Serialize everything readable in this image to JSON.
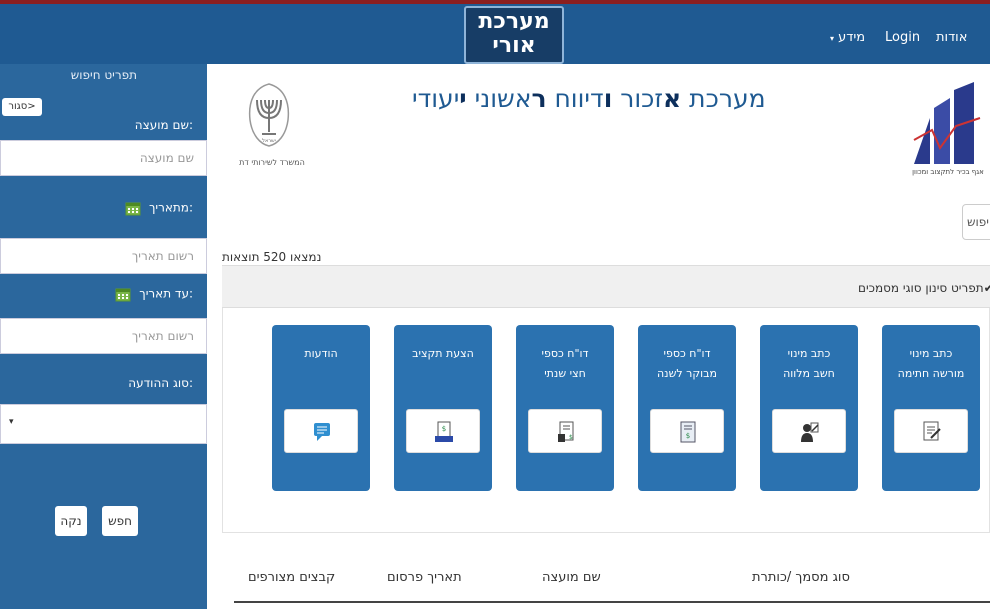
{
  "nav": {
    "brand_line1": "מערכת",
    "brand_line2": "אורי",
    "about": "אודות",
    "login": "Login",
    "info": "מידע",
    "info_caret": "▾"
  },
  "header": {
    "title_prefix": "מערכת ",
    "title_b1": "א",
    "title_p1": "זכור ",
    "title_b2": "ו",
    "title_p2": "דיווח ",
    "title_b3": "ר",
    "title_p3": "אשוני ",
    "title_b4": "י",
    "title_p4": "יעודי",
    "emblem_caption": "המשרד לשירותי דת",
    "emblem_text": "ישראל",
    "logo_caption": "אגף בכיר לתקצוב ומכוון"
  },
  "sidebar": {
    "title": "תפריט חיפוש",
    "collapse": "סגור>",
    "council_label": "שם מועצה:",
    "council_placeholder": "שם מועצה",
    "from_label": "מתאריך:",
    "from_placeholder": "רשום תאריך",
    "to_label": "עד תאריך:",
    "to_placeholder": "רשום תאריך",
    "type_label": "סוג ההודעה:",
    "type_arrow": "▾",
    "search_btn": "חפש",
    "clear_btn": "נקה"
  },
  "search": {
    "label": "חיפוש"
  },
  "results": {
    "count_text": "נמצאו 520 תוצאות"
  },
  "filter": {
    "label": "תפריט סינון סוגי מסמכים",
    "chevron": "✔"
  },
  "cards": [
    {
      "line1": "כתב מינוי",
      "line2": "מורשה חתימה",
      "icon": "signature-doc-icon"
    },
    {
      "line1": "כתב מינוי",
      "line2": "חשב מלווה",
      "icon": "accountant-icon"
    },
    {
      "line1": "דו\"ח כספי",
      "line2": "מבוקר לשנה",
      "icon": "annual-report-icon"
    },
    {
      "line1": "דו\"ח כספי",
      "line2": "חצי שנתי",
      "icon": "semiannual-report-icon"
    },
    {
      "line1": "הצעת תקציב",
      "line2": "",
      "icon": "budget-proposal-icon"
    },
    {
      "line1": "הודעות",
      "line2": "",
      "icon": "messages-icon"
    }
  ],
  "table": {
    "col_doc": "סוג מסמך /כותרת",
    "col_council": "שם מועצה",
    "col_date": "תאריך פרסום",
    "col_files": "קבצים מצורפים"
  },
  "colors": {
    "primary": "#1f5a92",
    "sidebar": "#2b679d",
    "card": "#2b72b0",
    "accent": "#8b1f1f"
  }
}
